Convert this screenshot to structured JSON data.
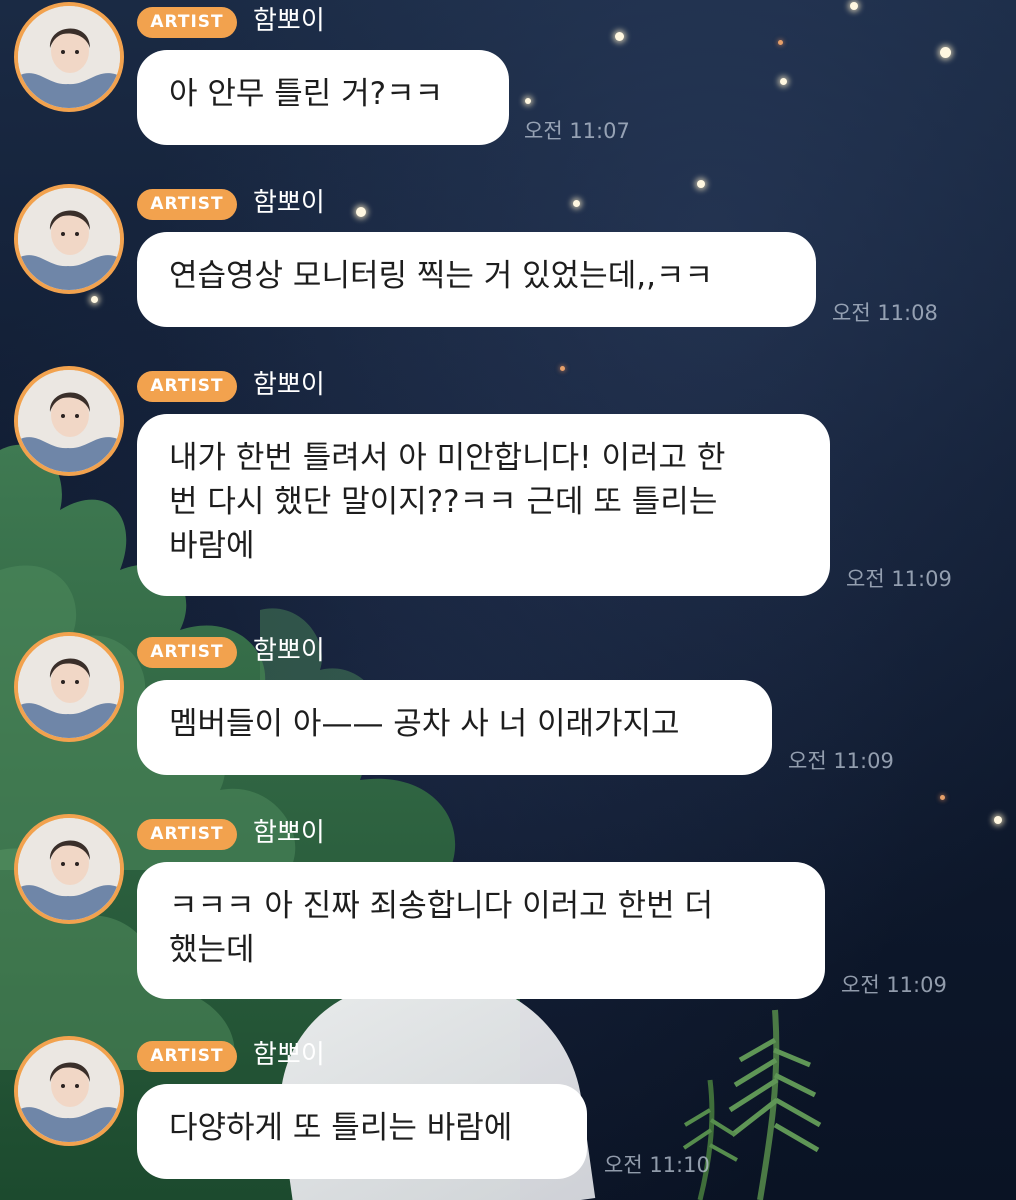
{
  "messages": [
    {
      "badge": "ARTIST",
      "sender": "함뽀이",
      "text": "아 안무 틀린 거?ㅋㅋ",
      "time": "오전 11:07"
    },
    {
      "badge": "ARTIST",
      "sender": "함뽀이",
      "text": "연습영상 모니터링 찍는 거 있었는데,,ㅋㅋ",
      "time": "오전 11:08"
    },
    {
      "badge": "ARTIST",
      "sender": "함뽀이",
      "text": "내가 한번 틀려서 아 미안합니다! 이러고 한\n번 다시 했단 말이지??ㅋㅋ 근데 또 틀리는\n바람에",
      "time": "오전 11:09"
    },
    {
      "badge": "ARTIST",
      "sender": "함뽀이",
      "text": "멤버들이 아—— 공차 사 너 이래가지고",
      "time": "오전 11:09"
    },
    {
      "badge": "ARTIST",
      "sender": "함뽀이",
      "text": "ㅋㅋㅋ 아 진짜 죄송합니다 이러고 한번 더\n했는데",
      "time": "오전 11:09"
    },
    {
      "badge": "ARTIST",
      "sender": "함뽀이",
      "text": "다양하게 또 틀리는 바람에",
      "time": "오전 11:10"
    }
  ],
  "colors": {
    "badge": "#f2a24e",
    "avatar_ring": "#f2a24e",
    "bubble": "#ffffff",
    "timestamp": "#bec8d7"
  },
  "icons": [
    "artist-avatar-icon"
  ]
}
